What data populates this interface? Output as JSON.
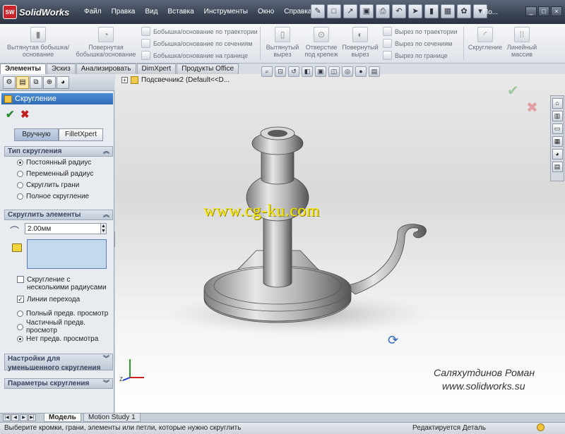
{
  "app": {
    "name": "SolidWorks",
    "logo_mark": "SW",
    "window_title": "По..."
  },
  "menu": [
    "Файл",
    "Правка",
    "Вид",
    "Вставка",
    "Инструменты",
    "Окно",
    "Справка"
  ],
  "ribbon": {
    "extrude_boss": "Вытянутая бобышка/основание",
    "revolve_boss": "Повернутая бобышка/основание",
    "swept_boss": "Бобышка/основание по траектории",
    "loft_boss": "Бобышка/основание по сечениям",
    "boundary_boss": "Бобышка/основание на границе",
    "extrude_cut": "Вытянутый вырез",
    "hole_wizard": "Отверстие под крепеж",
    "revolve_cut": "Повернутый вырез",
    "swept_cut": "Вырез по траектории",
    "loft_cut": "Вырез по сечениям",
    "boundary_cut": "Вырез по границе",
    "fillet": "Скругление",
    "linear_pattern": "Линейный массив"
  },
  "tabs": [
    "Элементы",
    "Эскиз",
    "Анализировать",
    "DimXpert",
    "Продукты Office"
  ],
  "property_manager": {
    "title": "Скругление",
    "mode_manual": "Вручную",
    "mode_xpert": "FilletXpert",
    "fillet_type": {
      "header": "Тип скругления",
      "options": [
        "Постоянный радиус",
        "Переменный радиус",
        "Скруглить грани",
        "Полное скругление"
      ]
    },
    "items_to_fillet": {
      "header": "Скруглить элементы",
      "radius": "2.00мм",
      "multi_radius": "Скругление с несколькими радиусами",
      "tangent": "Линии перехода",
      "preview_full": "Полный предв. просмотр",
      "preview_partial": "Частичный предв. просмотр",
      "preview_none": "Нет предв. просмотра"
    },
    "setback": "Настройки для уменьшенного скругления",
    "options_header": "Параметры скругления"
  },
  "viewport": {
    "tree_item": "Подсвечник2  (Default<<D...",
    "watermark": "www.cg-ku.com",
    "credit_name": "Саляхутдинов Роман",
    "credit_site": "www.solidworks.su"
  },
  "bottom_tabs": [
    "Модель",
    "Motion Study 1"
  ],
  "status": {
    "message": "Выберите кромки, грани, элементы или петли, которые нужно скруглить",
    "editing": "Редактируется Деталь"
  }
}
